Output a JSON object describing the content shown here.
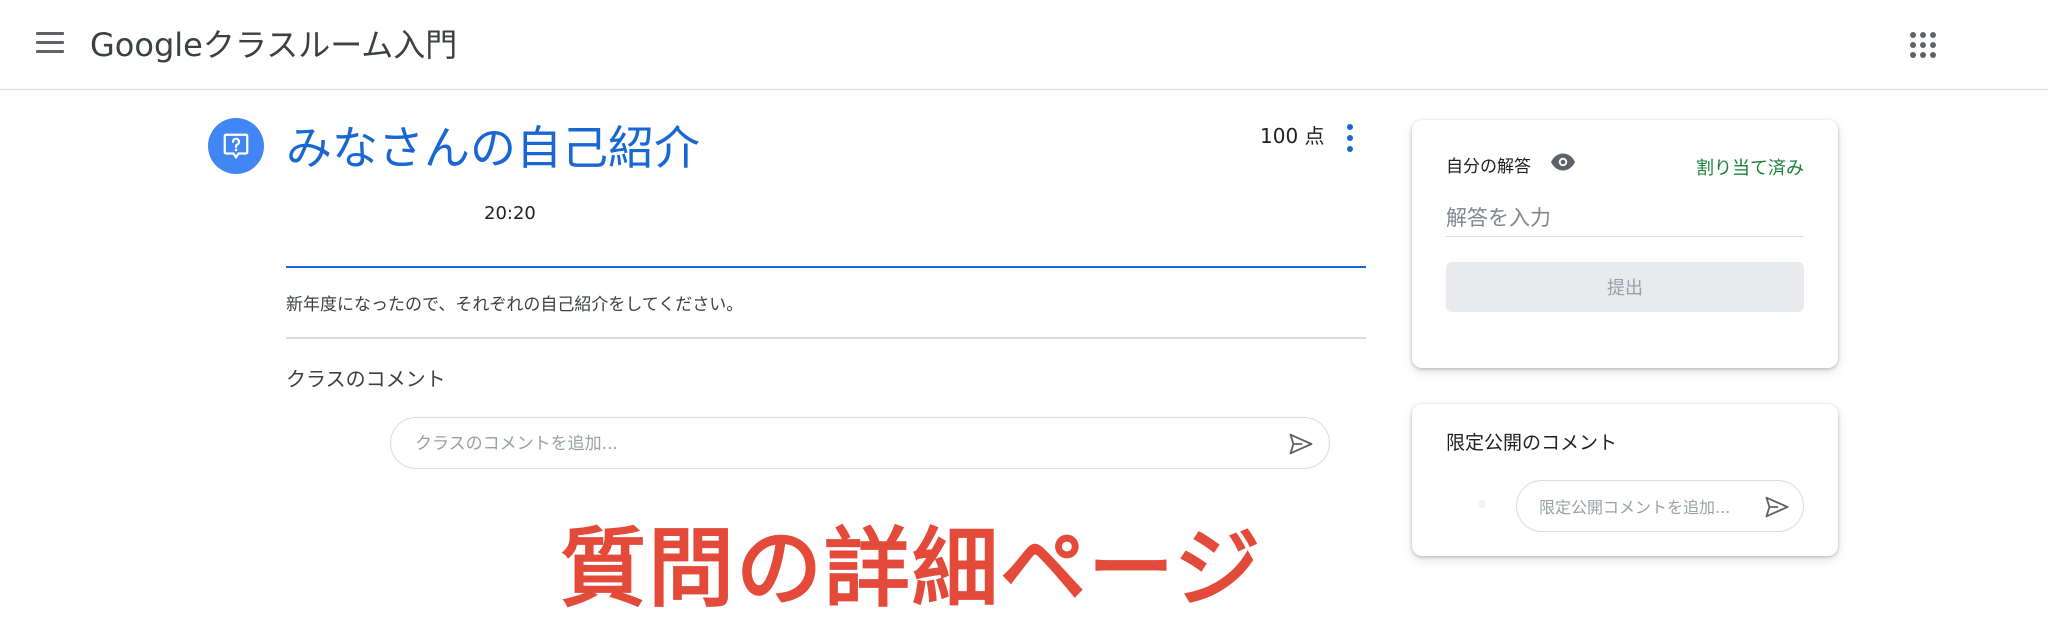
{
  "header": {
    "title": "Googleクラスルーム入門",
    "menu_icon": "menu-icon",
    "apps_icon": "apps-grid-icon"
  },
  "assignment": {
    "icon": "question-icon",
    "title": "みなさんの自己紹介",
    "points": "100 点",
    "time": "20:20",
    "description": "新年度になったので、それぞれの自己紹介をしてください。"
  },
  "class_comments": {
    "title": "クラスのコメント",
    "placeholder": "クラスのコメントを追加..."
  },
  "your_work": {
    "label": "自分の解答",
    "status": "割り当て済み",
    "answer_placeholder": "解答を入力",
    "submit_label": "提出"
  },
  "private_comments": {
    "title": "限定公開のコメント",
    "placeholder": "限定公開コメントを追加..."
  },
  "overlay_caption": "質問の詳細ページ",
  "colors": {
    "accent_blue": "#1967d2",
    "icon_blue": "#4285f4",
    "status_green": "#188038",
    "caption_red": "#e44a3a",
    "divider_grey": "#dadce0"
  }
}
